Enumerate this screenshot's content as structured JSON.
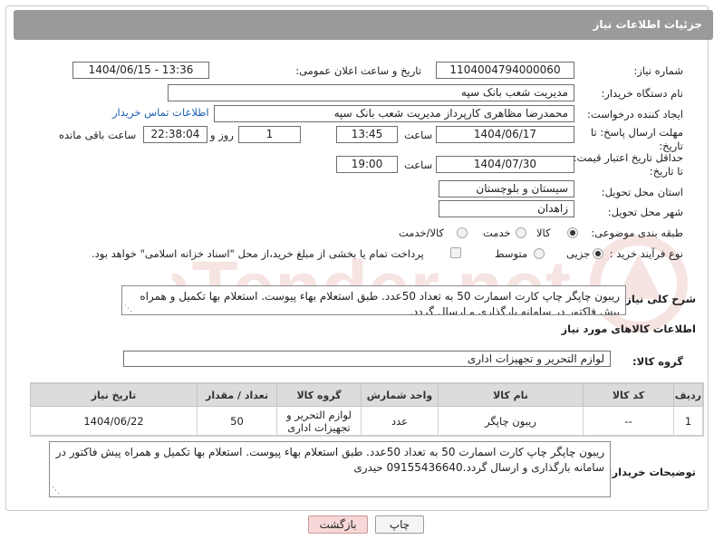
{
  "header": {
    "title": "جزئیات اطلاعات نیاز"
  },
  "fields": {
    "need_number_label": "شماره نیاز:",
    "need_number": "1104004794000060",
    "announce_label": "تاریخ و ساعت اعلان عمومی:",
    "announce_value": "1404/06/15 - 13:36",
    "buyer_org_label": "نام دستگاه خریدار:",
    "buyer_org": "مدیریت شعب بانک سپه",
    "requester_label": "ایجاد کننده درخواست:",
    "requester": "محمدرضا مظاهری کارپرداز مدیریت شعب بانک سپه",
    "buyer_contact_link": "اطلاعات تماس خریدار",
    "reply_deadline_label_1": "مهلت ارسال پاسخ: تا",
    "reply_deadline_label_2": "تاریخ:",
    "reply_date": "1404/06/17",
    "time_label": "ساعت",
    "reply_time": "13:45",
    "days_value": "1",
    "days_label": "روز و",
    "remaining_time": "22:38:04",
    "remaining_label": "ساعت باقی مانده",
    "price_validity_label_1": "حداقل تاریخ اعتبار قیمت:",
    "price_validity_label_2": "تا تاریخ:",
    "price_date": "1404/07/30",
    "price_time": "19:00",
    "province_label": "استان محل تحویل:",
    "province": "سیستان و بلوچستان",
    "city_label": "شهر محل تحویل:",
    "city": "زاهدان",
    "category_label": "طبقه بندی موضوعی:",
    "category_options": [
      "کالا",
      "خدمت",
      "کالا/خدمت"
    ],
    "category_selected": "کالا",
    "process_label": "نوع فرآیند خرید :",
    "process_options": [
      "جزیی",
      "متوسط"
    ],
    "process_selected": "جزیی",
    "payment_note": "پرداخت تمام یا بخشی از مبلغ خرید،از محل \"اسناد خزانه اسلامی\" خواهد بود.",
    "description_label": "شرح کلی نیاز:",
    "description": "ریبون چاپگر چاپ کارت اسمارت 50 به تعداد 50عدد. طبق استعلام بهاء پیوست. استعلام بها تکمیل و همراه پیش فاکتور در سامانه بارگذاری و ارسال گردد."
  },
  "goods": {
    "section_title": "اطلاعات کالاهای مورد نیاز",
    "group_label": "گروه کالا:",
    "group_value": "لوازم التحریر و تجهیزات اداری",
    "columns": [
      "ردیف",
      "کد کالا",
      "نام کالا",
      "واحد شمارش",
      "گروه کالا",
      "تعداد / مقدار",
      "تاریخ نیاز"
    ],
    "rows": [
      {
        "row": "1",
        "code": "--",
        "name": "ریبون چاپگر",
        "unit": "عدد",
        "group": "لوازم التحریر و تجهیزات اداری",
        "qty": "50",
        "date": "1404/06/22"
      }
    ]
  },
  "buyer_notes": {
    "label": "توضیحات خریدار:",
    "text": "ریبون چاپگر چاپ کارت اسمارت 50 به تعداد 50عدد. طبق استعلام بهاء پیوست. استعلام بها تکمیل و همراه پیش فاکتور در سامانه بارگذاری و ارسال گردد.09155436640 حیدری"
  },
  "buttons": {
    "print": "چاپ",
    "back": "بازگشت"
  },
  "watermark": {
    "brand": "AriaTender.net"
  },
  "colors": {
    "header_bg": "#9a9a9a",
    "link": "#1a5fb4",
    "back_button_bg": "#f7d7d7"
  }
}
